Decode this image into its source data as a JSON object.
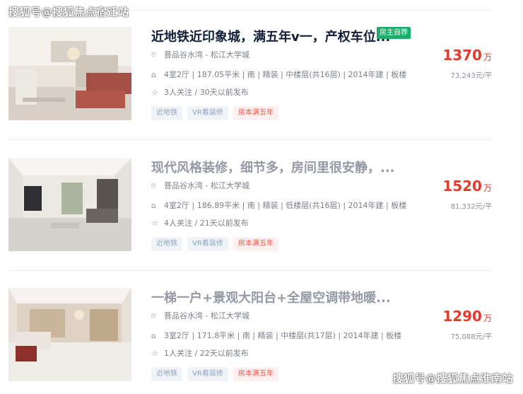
{
  "watermarks": {
    "top": "搜狐号@搜狐焦点宿迁站",
    "bottom": "搜狐号@搜狐焦点淮南站"
  },
  "colors": {
    "title": "#101d37",
    "title_muted": "#9399a5",
    "price": "#e5392c",
    "badge": "#1aae6a",
    "tag_text": "#8da3bf",
    "tag_red_text": "#e5574d"
  },
  "listings": [
    {
      "title": "近地铁近印象城，满五年v一，产权车位...",
      "badge": "房主自荐",
      "community": "菩品谷水湾 - 松江大学城",
      "info": "4室2厅 | 187.05平米 | 南 | 精装 | 中楼层(共16层) | 2014年建 | 板楼",
      "follow": "3人关注 / 30天以前发布",
      "tags": [
        "近地铁",
        "VR看装修",
        "房本满五年"
      ],
      "price": "1370",
      "price_unit": "万",
      "unit_price": "73,243元/平"
    },
    {
      "title": "现代风格装修，细节多，房间里很安静，...",
      "community": "菩品谷水湾 - 松江大学城",
      "info": "4室2厅 | 186.89平米 | 南 | 精装 | 低楼层(共16层) | 2014年建 | 板楼",
      "follow": "4人关注 / 21天以前发布",
      "tags": [
        "近地铁",
        "VR看装修",
        "房本满五年"
      ],
      "price": "1520",
      "price_unit": "万",
      "unit_price": "81,332元/平"
    },
    {
      "title": "一梯一户+景观大阳台+全屋空调带地暖...",
      "community": "菩品谷水湾 - 松江大学城",
      "info": "3室2厅 | 171.8平米 | 南 | 精装 | 中楼层(共17层) | 2014年建 | 板楼",
      "follow": "1人关注 / 22天以前发布",
      "tags": [
        "近地铁",
        "VR看装修",
        "房本满五年"
      ],
      "price": "1290",
      "price_unit": "万",
      "unit_price": "75,088元/平"
    }
  ]
}
